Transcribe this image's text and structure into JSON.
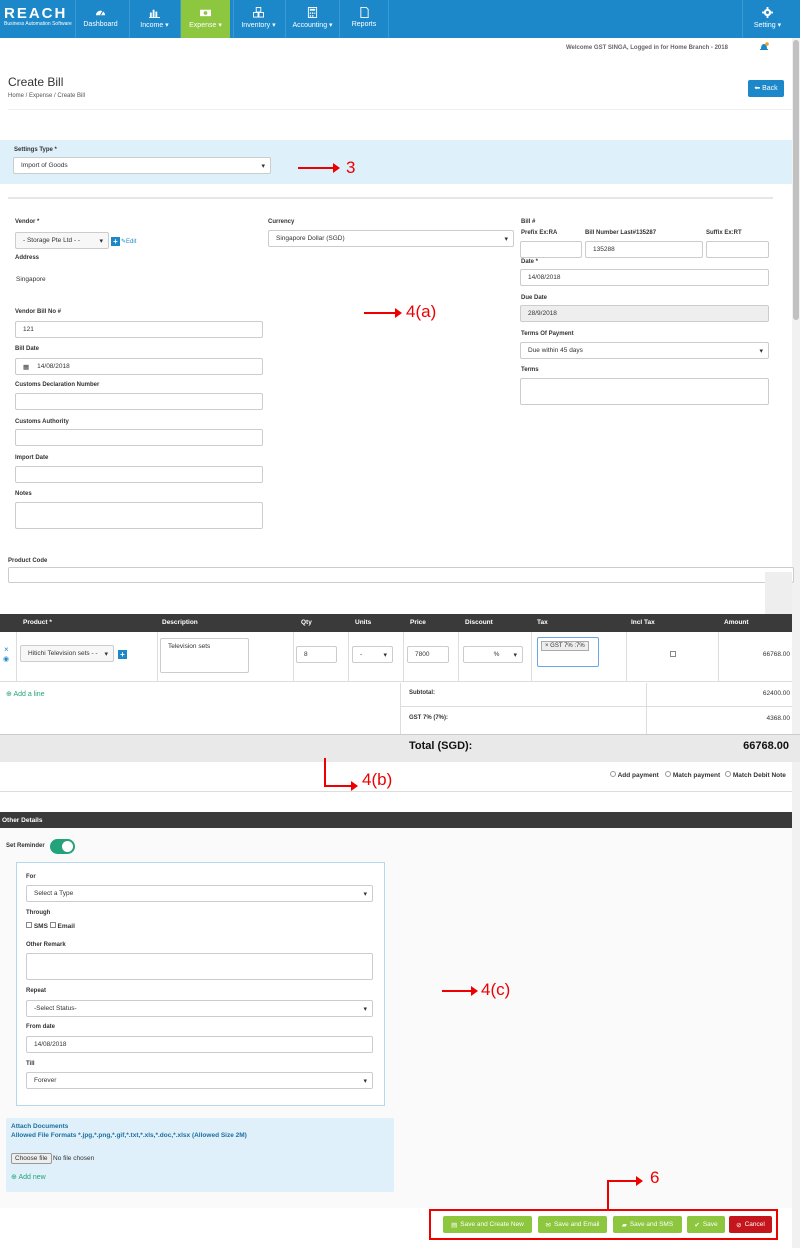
{
  "nav": {
    "logo_main": "REACH",
    "logo_sub": "Business Automation Software",
    "items": [
      {
        "label": "Dashboard"
      },
      {
        "label": "Income ▾"
      },
      {
        "label": "Expense ▾"
      },
      {
        "label": "Inventory ▾"
      },
      {
        "label": "Accounting ▾"
      },
      {
        "label": "Reports"
      }
    ],
    "setting_label": "Setting ▾"
  },
  "welcome": "Welcome GST SINGA, Logged in for Home Branch - 2018",
  "page": {
    "title": "Create Bill",
    "breadcrumb": "Home /  Expense /  Create Bill",
    "back_label": "Back"
  },
  "settings": {
    "label": "Settings Type *",
    "value": "Import of Goods"
  },
  "annotations": {
    "a3": "3",
    "a4a": "4(a)",
    "a4b": "4(b)",
    "a4c": "4(c)",
    "a6": "6"
  },
  "vendor": {
    "label": "Vendor *",
    "value": "- Storage Pte Ltd - -",
    "edit_label": "Edit",
    "address_label": "Address",
    "address_value": "Singapore",
    "bill_no_label": "Vendor Bill No #",
    "bill_no_value": "121",
    "bill_date_label": "Bill Date",
    "bill_date_value": "14/08/2018",
    "customs_decl_label": "Customs Declaration Number",
    "customs_auth_label": "Customs Authority",
    "import_date_label": "Import Date",
    "notes_label": "Notes"
  },
  "currency": {
    "label": "Currency",
    "value": "Singapore Dollar (SGD)"
  },
  "bill": {
    "label": "Bill #",
    "prefix_label": "Prefix Ex:RA",
    "number_label": "Bill Number Last#135287",
    "number_value": "135288",
    "suffix_label": "Suffix Ex:RT",
    "date_label": "Date *",
    "date_value": "14/08/2018",
    "due_label": "Due Date",
    "due_value": "28/9/2018",
    "terms_payment_label": "Terms Of Payment",
    "terms_payment_value": "Due within 45 days",
    "terms_label": "Terms"
  },
  "product_code_label": "Product Code",
  "table": {
    "headers": [
      "Product *",
      "Description",
      "Qty",
      "Units",
      "Price",
      "Discount",
      "Tax",
      "Incl Tax",
      "Amount"
    ],
    "row": {
      "product": "Hitichi Television sets - -",
      "description": "Television sets",
      "qty": "8",
      "units": "-",
      "price": "7800",
      "discount_type": "%",
      "tax_tag": "GST 7% :7%",
      "amount": "66768.00"
    }
  },
  "add_line": "Add a line",
  "totals": {
    "subtotal_label": "Subtotal:",
    "subtotal_value": "62400.00",
    "gst_label": "GST 7% (7%):",
    "gst_value": "4368.00",
    "total_label": "Total (SGD):",
    "total_value": "66768.00"
  },
  "payment_options": [
    "Add payment",
    "Match payment",
    "Match Debit Note"
  ],
  "other_details": {
    "title": "Other Details",
    "reminder_label": "Set Reminder",
    "for_label": "For",
    "for_value": "Select a Type",
    "through_label": "Through",
    "sms_label": "SMS",
    "email_label": "Email",
    "remark_label": "Other Remark",
    "repeat_label": "Repeat",
    "repeat_value": "-Select Status-",
    "from_label": "From date",
    "from_value": "14/08/2018",
    "till_label": "Till",
    "till_value": "Forever"
  },
  "attach": {
    "title": "Attach Documents",
    "formats": "Allowed File Formats *.jpg,*.png,*.gif,*.txt,*.xls,*.doc,*.xlsx (Allowed Size 2M)",
    "choose_label": "Choose file",
    "no_file": "No file chosen",
    "add_new": "Add new"
  },
  "actions": {
    "save_create_new": "Save and Create New",
    "save_email": "Save and Email",
    "save_sms": "Save and SMS",
    "save": "Save",
    "cancel": "Cancel"
  },
  "colors": {
    "nav_blue": "#1c87c9",
    "active_green": "#8dc63f",
    "cancel_red": "#c4161c",
    "annotation_red": "#ee0000",
    "toggle_teal": "#24a27a"
  }
}
